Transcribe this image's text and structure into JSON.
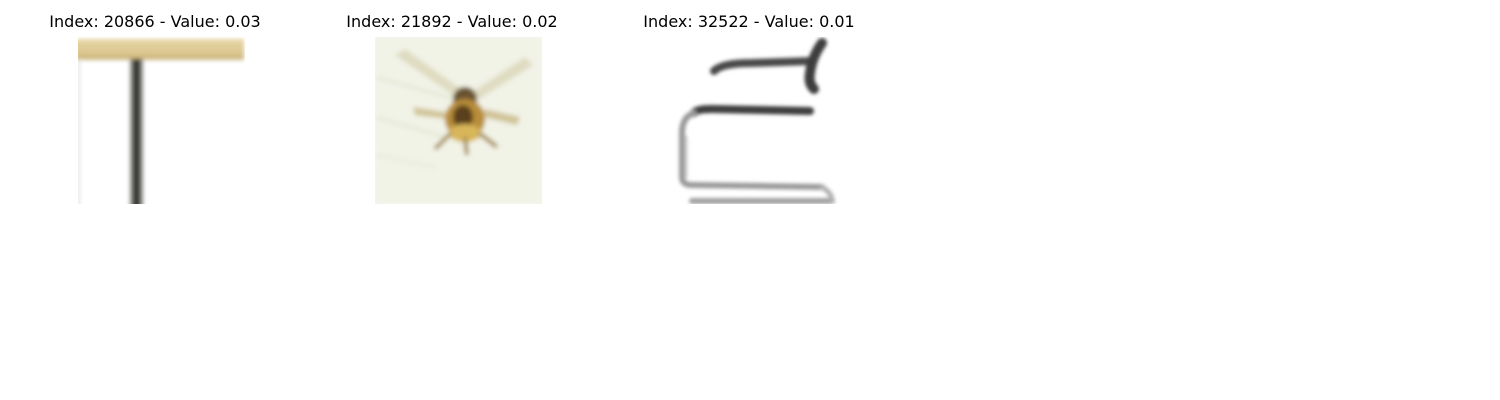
{
  "panels": [
    {
      "title": "Index: 20866 - Value: 0.03",
      "image_subject": "table"
    },
    {
      "title": "Index: 21892 - Value: 0.02",
      "image_subject": "insect"
    },
    {
      "title": "Index: 32522 - Value: 0.01",
      "image_subject": "chair"
    }
  ]
}
